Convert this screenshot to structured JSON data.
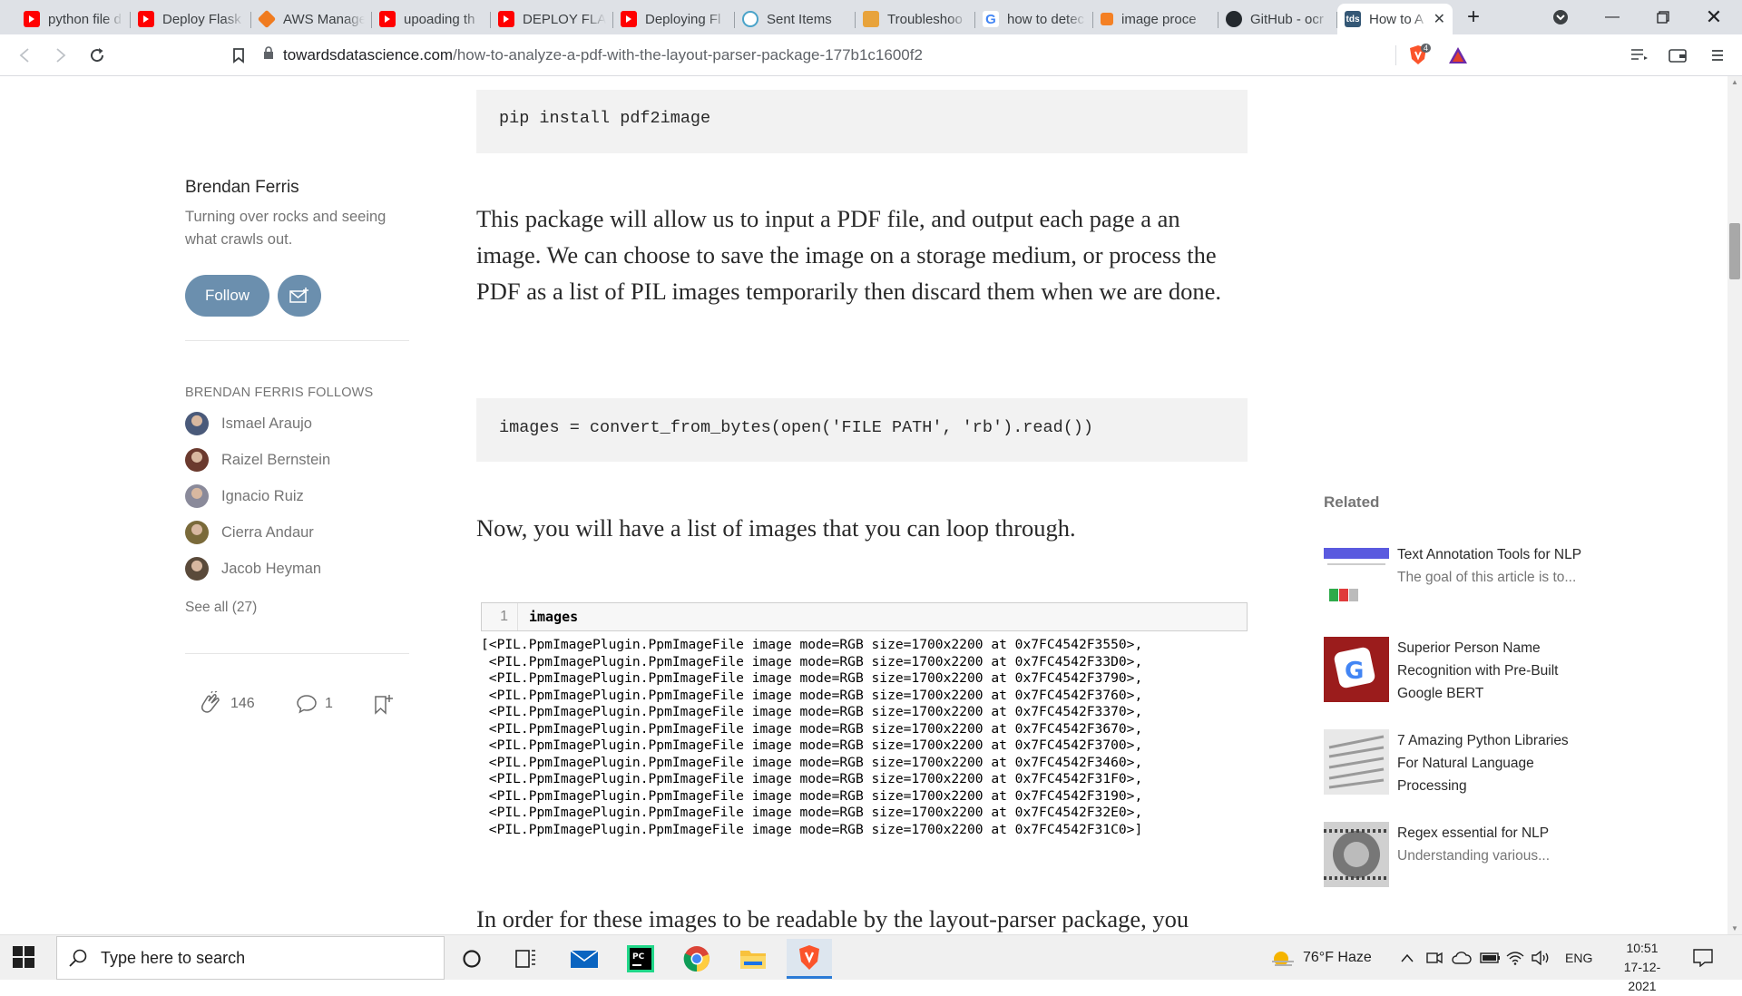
{
  "browser": {
    "tabs": [
      {
        "title": "python file d",
        "favicon": "youtube-icon"
      },
      {
        "title": "Deploy Flask",
        "favicon": "youtube-icon"
      },
      {
        "title": "AWS Manage",
        "favicon": "aws-icon"
      },
      {
        "title": "upoading th",
        "favicon": "youtube-icon"
      },
      {
        "title": "DEPLOY FLAS",
        "favicon": "youtube-icon"
      },
      {
        "title": "Deploying Fl",
        "favicon": "youtube-icon"
      },
      {
        "title": "Sent Items",
        "favicon": "mail-icon"
      },
      {
        "title": "Troubleshoo",
        "favicon": "doc-icon"
      },
      {
        "title": "how to detec",
        "favicon": "google-icon"
      },
      {
        "title": "image proce",
        "favicon": "stack-icon"
      },
      {
        "title": "GitHub - ocr",
        "favicon": "github-icon"
      },
      {
        "title": "How to A",
        "favicon": "tds-icon"
      }
    ],
    "active_tab_favicon_text": "tds",
    "url_host": "towardsdatascience.com",
    "url_path": "/how-to-analyze-a-pdf-with-the-layout-parser-package-177b1c1600f2",
    "brave_badge": "4"
  },
  "article": {
    "code1": "pip install pdf2image",
    "para1": "This package will allow us to input a PDF file, and output each page a an image. We can choose to save the image on a storage medium, or process the PDF as a list of PIL images temporarily then discard them when we are done.",
    "code2": "images = convert_from_bytes(open('FILE PATH', 'rb').read())",
    "para2": "Now, you will have a list of images that you can loop through.",
    "jupyter": {
      "cell_number": "1",
      "cell_input": "images",
      "output_lines": [
        "[<PIL.PpmImagePlugin.PpmImageFile image mode=RGB size=1700x2200 at 0x7FC4542F3550>,",
        " <PIL.PpmImagePlugin.PpmImageFile image mode=RGB size=1700x2200 at 0x7FC4542F33D0>,",
        " <PIL.PpmImagePlugin.PpmImageFile image mode=RGB size=1700x2200 at 0x7FC4542F3790>,",
        " <PIL.PpmImagePlugin.PpmImageFile image mode=RGB size=1700x2200 at 0x7FC4542F3760>,",
        " <PIL.PpmImagePlugin.PpmImageFile image mode=RGB size=1700x2200 at 0x7FC4542F3370>,",
        " <PIL.PpmImagePlugin.PpmImageFile image mode=RGB size=1700x2200 at 0x7FC4542F3670>,",
        " <PIL.PpmImagePlugin.PpmImageFile image mode=RGB size=1700x2200 at 0x7FC4542F3700>,",
        " <PIL.PpmImagePlugin.PpmImageFile image mode=RGB size=1700x2200 at 0x7FC4542F3460>,",
        " <PIL.PpmImagePlugin.PpmImageFile image mode=RGB size=1700x2200 at 0x7FC4542F31F0>,",
        " <PIL.PpmImagePlugin.PpmImageFile image mode=RGB size=1700x2200 at 0x7FC4542F3190>,",
        " <PIL.PpmImagePlugin.PpmImageFile image mode=RGB size=1700x2200 at 0x7FC4542F32E0>,",
        " <PIL.PpmImagePlugin.PpmImageFile image mode=RGB size=1700x2200 at 0x7FC4542F31C0>]"
      ]
    },
    "para3": "In order for these images to be readable by the layout-parser package, you"
  },
  "author": {
    "name": "Brendan Ferris",
    "bio": "Turning over rocks and seeing what crawls out.",
    "follow_label": "Follow",
    "follows_heading": "BRENDAN FERRIS FOLLOWS",
    "follows": [
      "Ismael Araujo",
      "Raizel Bernstein",
      "Ignacio Ruiz",
      "Cierra Andaur",
      "Jacob Heyman"
    ],
    "see_all": "See all (27)",
    "claps": "146",
    "responses": "1"
  },
  "related": {
    "heading": "Related",
    "items": [
      {
        "title": "Text Annotation Tools for NLP",
        "subtitle": "The goal of this article is to..."
      },
      {
        "title": "Superior Person Name Recognition with Pre-Built Google BERT",
        "subtitle": ""
      },
      {
        "title": "7 Amazing Python Libraries For Natural Language Processing",
        "subtitle": ""
      },
      {
        "title": "Regex essential for NLP",
        "subtitle": "Understanding various..."
      }
    ]
  },
  "taskbar": {
    "search_placeholder": "Type here to search",
    "weather": "76°F  Haze",
    "language": "ENG",
    "time": "10:51",
    "date": "17-12-2021"
  },
  "colors": {
    "accent": "#6b8fae",
    "code_bg": "#f2f2f2",
    "text": "#292929"
  }
}
